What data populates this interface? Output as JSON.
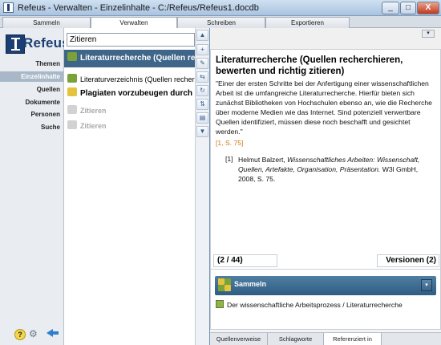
{
  "window": {
    "title": "Refeus - Verwalten - Einzelinhalte - C:/Refeus/Refeus1.docdb",
    "buttons": [
      "_",
      "□",
      "X"
    ]
  },
  "tabs": [
    {
      "label": "Sammeln",
      "active": false
    },
    {
      "label": "Verwalten",
      "active": true
    },
    {
      "label": "Schreiben",
      "active": false
    },
    {
      "label": "Exportieren",
      "active": false
    }
  ],
  "sidebar": {
    "logo": "Refeus",
    "items": [
      {
        "label": "Themen",
        "selected": false
      },
      {
        "label": "Einzelinhalte",
        "selected": true
      },
      {
        "label": "Quellen",
        "selected": false
      },
      {
        "label": "Dokumente",
        "selected": false
      },
      {
        "label": "Personen",
        "selected": false
      },
      {
        "label": "Suche",
        "selected": false
      }
    ],
    "footer_icons": [
      "help-icon",
      "gear-icon",
      "back-arrow-icon"
    ],
    "help_glyph": "?"
  },
  "list": {
    "search_value": "Zitieren",
    "rows": [
      {
        "text": "Literaturrecherche (Quellen recherchieren",
        "style": "sel",
        "icon": "green"
      },
      {
        "text": "Literaturverzeichnis (Quellen recherchieren",
        "style": "normal",
        "icon": "green"
      },
      {
        "text": "Plagiaten vorzubeugen durch richtige",
        "style": "bold",
        "icon": "yellow"
      },
      {
        "text": "Zitieren",
        "style": "gray",
        "icon": "lgray"
      },
      {
        "text": "Zitieren",
        "style": "gray",
        "icon": "lgray"
      }
    ],
    "toolbar_glyphs": [
      "▲",
      "+",
      "✎",
      "⇆",
      "↻",
      "⇅",
      "▤",
      "▼"
    ]
  },
  "detail": {
    "title": "Literaturrecherche (Quellen recherchieren, bewerten und richtig zitieren)",
    "quote": "\"Einer der ersten Schritte bei der Anfertigung einer wissenschaftlichen Arbeit ist die umfangreiche Literaturrecherche. Hierfür bieten sich zunächst Bibliotheken von Hochschulen ebenso an, wie die Recherche über moderne Medien wie das Internet. Sind potenziell verwertbare Quellen identifiziert, müssen diese noch beschafft und gesichtet werden.\"",
    "reference": "[1, S. 75]",
    "footnote_num": "[1]",
    "footnote_author": "Helmut Balzert,",
    "footnote_work": "Wissenschaftliches Arbeiten: Wissenschaft, Quellen, Artefakte, Organisation, Präsentation.",
    "footnote_rest": "W3l GmbH, 2008, S. 75.",
    "counter": "(2 / 44)",
    "versions": "Versionen (2)",
    "collapse_glyph": "▾"
  },
  "sammeln": {
    "label": "Sammeln",
    "item": "Der wissenschaftliche Arbeitsprozess / Literaturrecherche",
    "dropdown_glyph": "▾"
  },
  "bottom_tabs": [
    {
      "label": "Quellenverweise",
      "active": false
    },
    {
      "label": "Schlagworte",
      "active": false
    },
    {
      "label": "Referenziert in",
      "active": true
    }
  ],
  "colors": {
    "selection": "#3f6689",
    "sammeln_bar": "#2f5c82",
    "reference": "#d07a12"
  }
}
